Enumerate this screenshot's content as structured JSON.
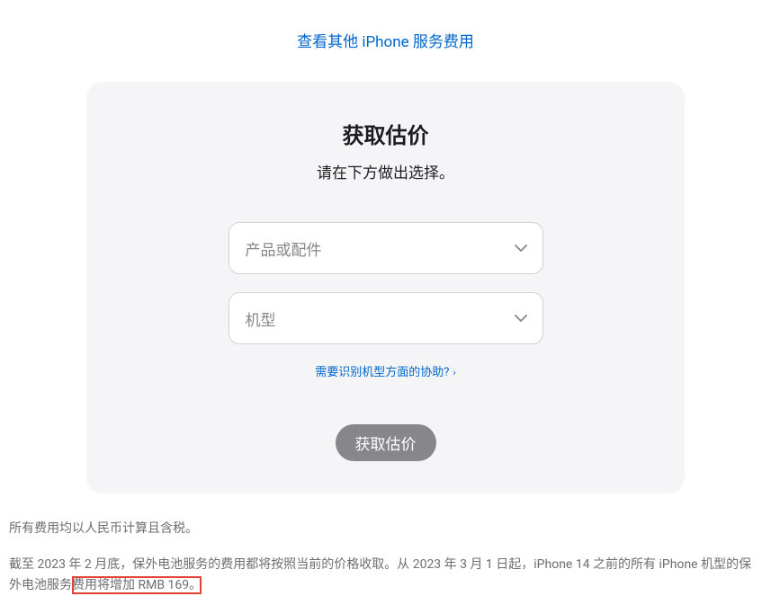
{
  "topLink": {
    "label": "查看其他 iPhone 服务费用"
  },
  "card": {
    "title": "获取估价",
    "subtitle": "请在下方做出选择。",
    "select1": {
      "placeholder": "产品或配件"
    },
    "select2": {
      "placeholder": "机型"
    },
    "helpLink": {
      "label": "需要识别机型方面的协助?"
    },
    "button": {
      "label": "获取估价"
    }
  },
  "footnotes": {
    "line1": "所有费用均以人民币计算且含税。",
    "line2_part1": "截至 2023 年 2 月底，保外电池服务的费用都将按照当前的价格收取。从 2023 年 3 月 1 日起，iPhone 14 之前的所有 iPhone 机型的保外电池服务",
    "line2_highlight": "费用将增加 RMB 169。"
  }
}
